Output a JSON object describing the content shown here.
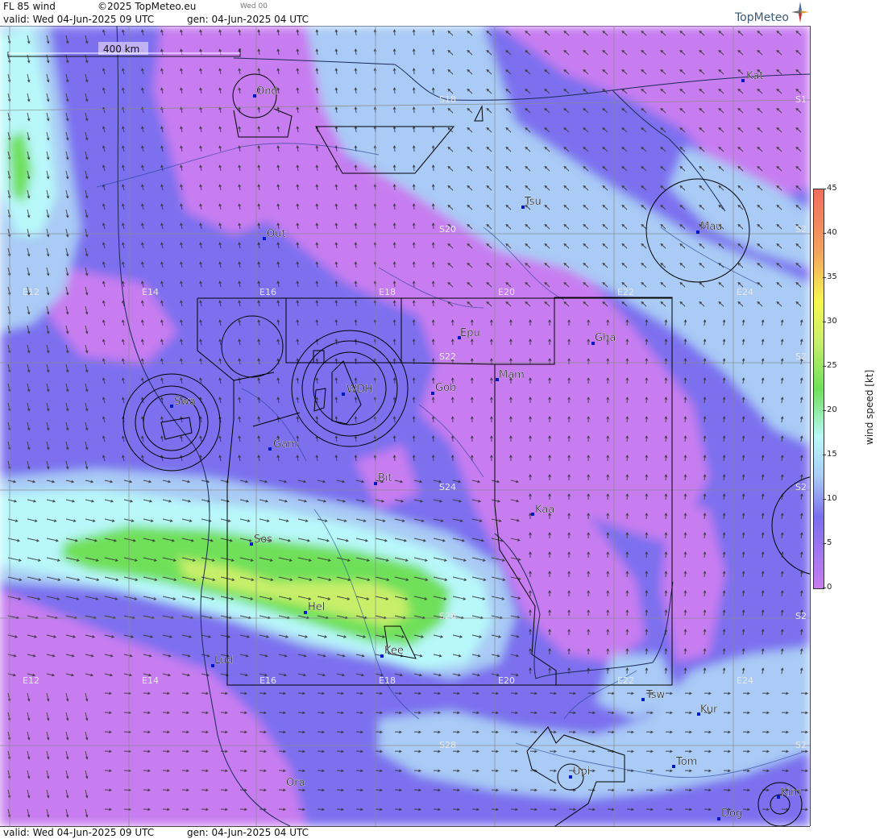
{
  "header": {
    "product": "FL 85 wind",
    "copyright": "©2025 TopMeteo.eu",
    "small_day": "Wed 00",
    "valid": "valid:  Wed  04-Jun-2025  09 UTC",
    "gen": "gen: 04-Jun-2025 04 UTC",
    "brand": "TopMeteo"
  },
  "footer": {
    "valid": "valid:  Wed  04-Jun-2025  09 UTC",
    "gen": "gen: 04-Jun-2025 04 UTC"
  },
  "map": {
    "scale_label": "400 km",
    "longitude_labels": [
      "E12",
      "E14",
      "E16",
      "E18",
      "E20",
      "E22",
      "E24"
    ],
    "latitude_labels": [
      "S18",
      "S20",
      "S22",
      "S24",
      "S26",
      "S28"
    ],
    "lat_edge_prefix": "S2",
    "lat_edge_prefix_top": "S1",
    "places": [
      "Ond",
      "Kat",
      "Tsu",
      "Mau",
      "Out",
      "Epu",
      "Gha",
      "Mam",
      "WDH",
      "Gob",
      "Swa",
      "Gam",
      "Bit",
      "Kaa",
      "Sos",
      "Hel",
      "Kee",
      "Lud",
      "Tsw",
      "Kur",
      "Tom",
      "Upi",
      "Ora",
      "Kim",
      "Dog"
    ]
  },
  "colorbar": {
    "title": "wind speed [kt]",
    "ticks": [
      "45",
      "40",
      "35",
      "30",
      "25",
      "20",
      "15",
      "10",
      "5",
      "0"
    ],
    "colors": {
      "c0": "#c77df0",
      "c5": "#7b6fef",
      "c10": "#a9cbf5",
      "c15": "#b8f8fa",
      "c20": "#6fe05a",
      "c25": "#c9ef6a",
      "c30": "#f7f74f",
      "c35": "#f3a45e",
      "c45": "#f26b5e"
    }
  }
}
